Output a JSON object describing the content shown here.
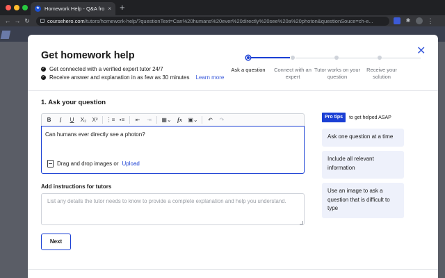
{
  "browser": {
    "tab_title": "Homework Help - Q&A from Online Tutors",
    "tab_close": "×",
    "new_tab": "+",
    "url_domain": "coursehero.com",
    "url_path": "/tutors/homework-help/?questionText=Can%20humans%20ever%20directly%20see%20a%20photon&questionSouce=ch-e...",
    "back": "←",
    "forward": "→",
    "reload": "↻",
    "menu": "⋮",
    "puzzle": "✱"
  },
  "modal": {
    "close": "✕",
    "title": "Get homework help",
    "bullets": [
      "Get connected with a verified expert tutor 24/7",
      "Receive answer and explanation in as few as 30 minutes"
    ],
    "learn_more": "Learn more",
    "check_glyph": "✓",
    "steps": [
      {
        "label": "Ask a question",
        "current": true
      },
      {
        "label": "Connect with an expert",
        "current": false
      },
      {
        "label": "Tutor works on your question",
        "current": false
      },
      {
        "label": "Receive your solution",
        "current": false
      }
    ]
  },
  "question": {
    "section_title": "1. Ask your question",
    "toolbar": {
      "bold": "B",
      "italic": "I",
      "underline": "U",
      "subscript": "X₂",
      "superscript": "X²",
      "ordered_list": "⋮≡",
      "bullet_list": "•≡",
      "outdent": "⇤",
      "indent": "⇥",
      "table": "▦⌄",
      "formula": "fx",
      "image": "▣⌄",
      "undo": "↶",
      "redo": "↷"
    },
    "text": "Can humans ever directly see a photon?",
    "upload_prefix": "Drag and drop images or",
    "upload_link": "Upload"
  },
  "instructions": {
    "label": "Add instructions for tutors",
    "placeholder": "List any details the tutor needs to know to provide a complete explanation and help you understand.",
    "value": ""
  },
  "next_button": "Next",
  "pro_tips": {
    "badge": "Pro tips",
    "subtitle": "to get helped ASAP",
    "tips": [
      "Ask one question at a time",
      "Include all relevant information",
      "Use an image to ask a question that is difficult to type"
    ]
  },
  "colors": {
    "accent": "#1a3fd4",
    "tip_background": "#eef1fb",
    "backdrop": "#5a5d66"
  }
}
